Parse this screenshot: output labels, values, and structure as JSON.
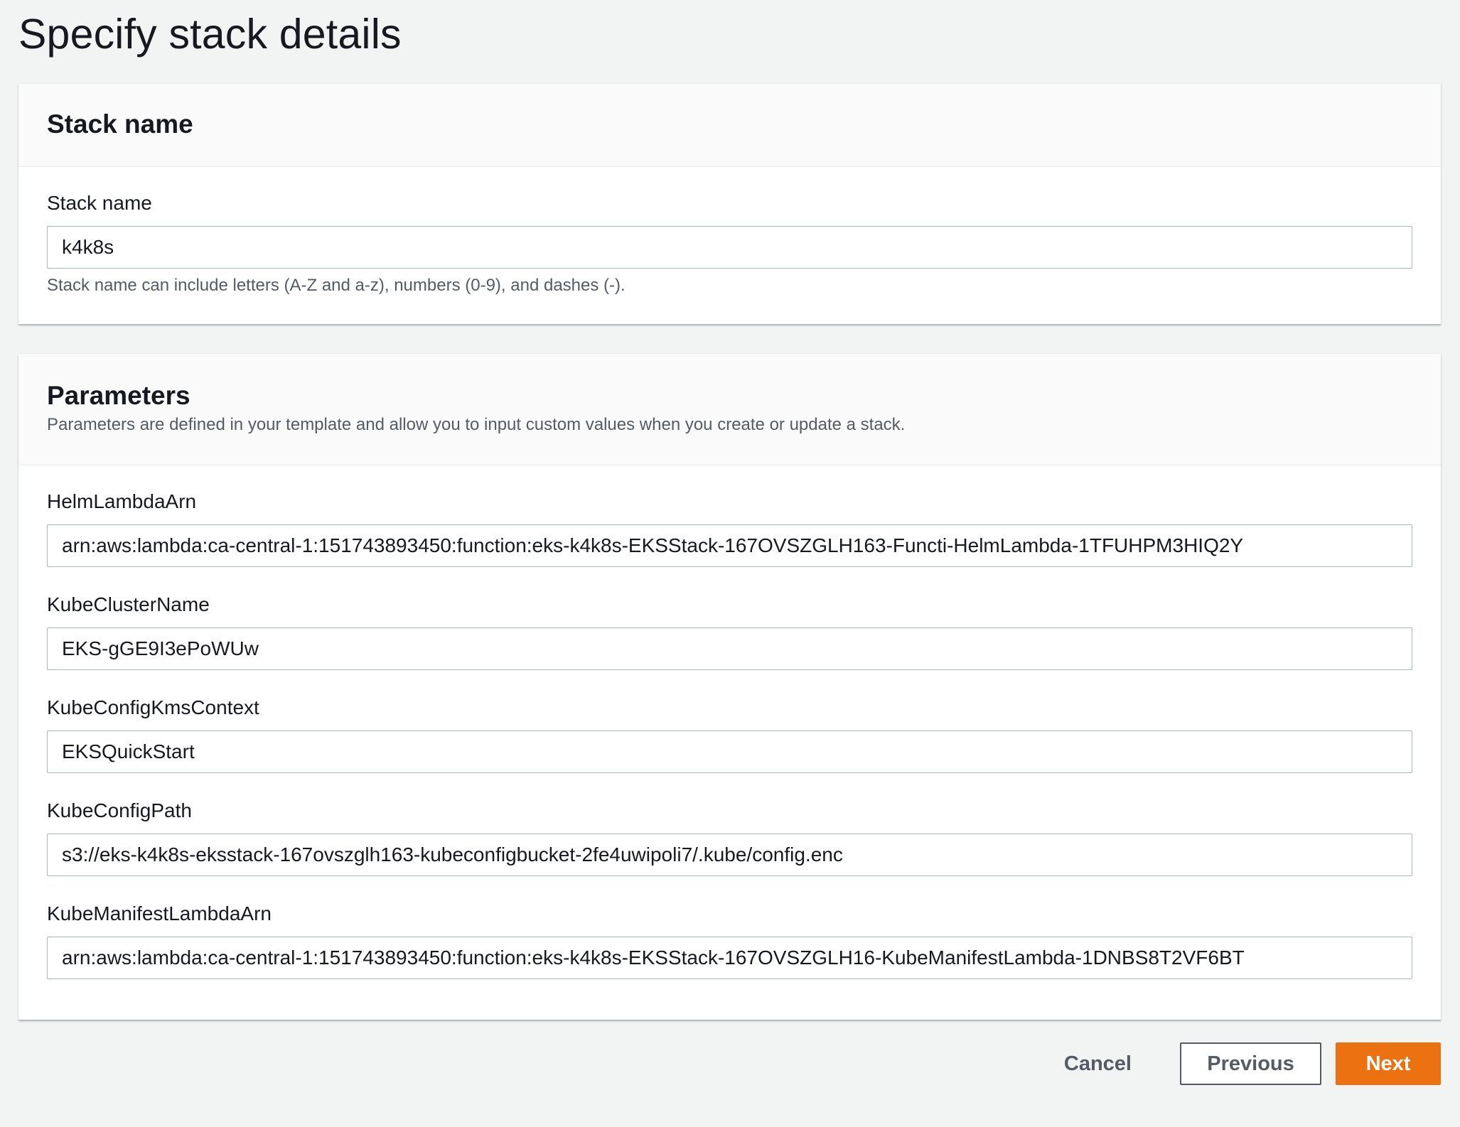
{
  "page": {
    "title": "Specify stack details"
  },
  "stack_name_panel": {
    "title": "Stack name",
    "field_label": "Stack name",
    "value": "k4k8s",
    "hint": "Stack name can include letters (A-Z and a-z), numbers (0-9), and dashes (-)."
  },
  "parameters_panel": {
    "title": "Parameters",
    "description": "Parameters are defined in your template and allow you to input custom values when you create or update a stack.",
    "fields": [
      {
        "label": "HelmLambdaArn",
        "value": "arn:aws:lambda:ca-central-1:151743893450:function:eks-k4k8s-EKSStack-167OVSZGLH163-Functi-HelmLambda-1TFUHPM3HIQ2Y"
      },
      {
        "label": "KubeClusterName",
        "value": "EKS-gGE9I3ePoWUw"
      },
      {
        "label": "KubeConfigKmsContext",
        "value": "EKSQuickStart"
      },
      {
        "label": "KubeConfigPath",
        "value": "s3://eks-k4k8s-eksstack-167ovszglh163-kubeconfigbucket-2fe4uwipoli7/.kube/config.enc"
      },
      {
        "label": "KubeManifestLambdaArn",
        "value": "arn:aws:lambda:ca-central-1:151743893450:function:eks-k4k8s-EKSStack-167OVSZGLH16-KubeManifestLambda-1DNBS8T2VF6BT"
      }
    ]
  },
  "footer": {
    "cancel_label": "Cancel",
    "previous_label": "Previous",
    "next_label": "Next"
  },
  "colors": {
    "primary_button": "#ec7211",
    "page_background": "#f2f3f3"
  }
}
